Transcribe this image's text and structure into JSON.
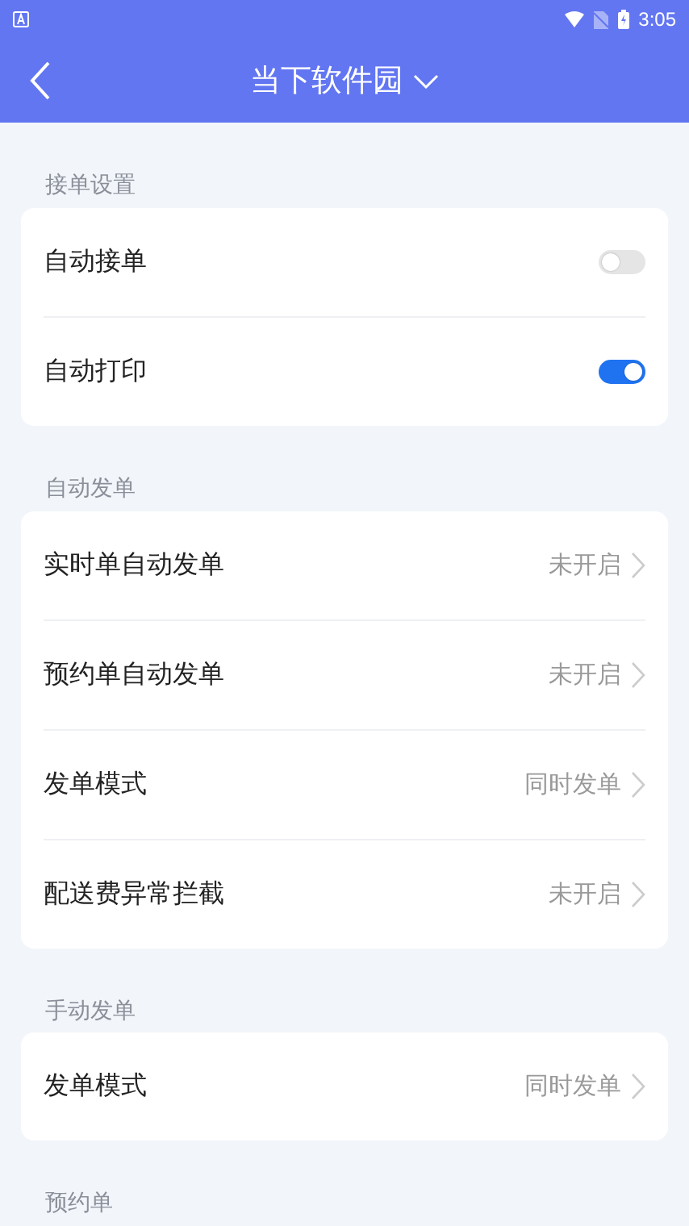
{
  "status_bar": {
    "time": "3:05"
  },
  "header": {
    "title": "当下软件园"
  },
  "sections": [
    {
      "title": "接单设置",
      "rows": [
        {
          "kind": "toggle",
          "label": "自动接单",
          "on": false
        },
        {
          "kind": "toggle",
          "label": "自动打印",
          "on": true
        }
      ]
    },
    {
      "title": "自动发单",
      "rows": [
        {
          "kind": "link",
          "label": "实时单自动发单",
          "value": "未开启"
        },
        {
          "kind": "link",
          "label": "预约单自动发单",
          "value": "未开启"
        },
        {
          "kind": "link",
          "label": "发单模式",
          "value": "同时发单"
        },
        {
          "kind": "link",
          "label": "配送费异常拦截",
          "value": "未开启"
        }
      ]
    },
    {
      "title": "手动发单",
      "rows": [
        {
          "kind": "link",
          "label": "发单模式",
          "value": "同时发单"
        }
      ]
    },
    {
      "title": "预约单"
    }
  ]
}
